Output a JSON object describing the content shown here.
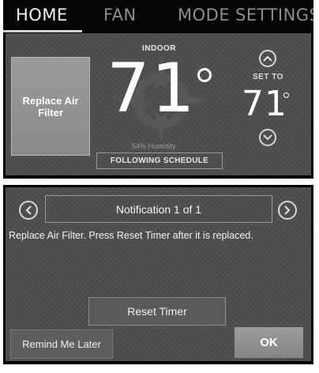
{
  "home_screen": {
    "tabs": [
      {
        "label": "HOME",
        "active": true
      },
      {
        "label": "FAN",
        "active": false
      },
      {
        "label": "MODE",
        "active": false
      },
      {
        "label": "SETTINGS",
        "active": false
      }
    ],
    "alert_tile": "Replace Air Filter",
    "indoor_label": "INDOOR",
    "indoor_temp": "71",
    "humidity": "54% Humidity",
    "schedule_button": "FOLLOWING SCHEDULE",
    "set_to_label": "SET TO",
    "set_temp": "71",
    "icons": {
      "increase": "chevron-up-icon",
      "decrease": "chevron-down-icon"
    }
  },
  "notification_screen": {
    "title": "Notification 1 of 1",
    "message": "Replace Air Filter. Press Reset Timer after it is replaced.",
    "reset_button": "Reset Timer",
    "remind_button": "Remind Me Later",
    "ok_button": "OK",
    "icons": {
      "previous": "chevron-left-icon",
      "next": "chevron-right-icon"
    }
  },
  "colors": {
    "background": "#4a4a4a",
    "frame": "#000000",
    "text": "#ffffff",
    "button": "#8f8f8f"
  }
}
